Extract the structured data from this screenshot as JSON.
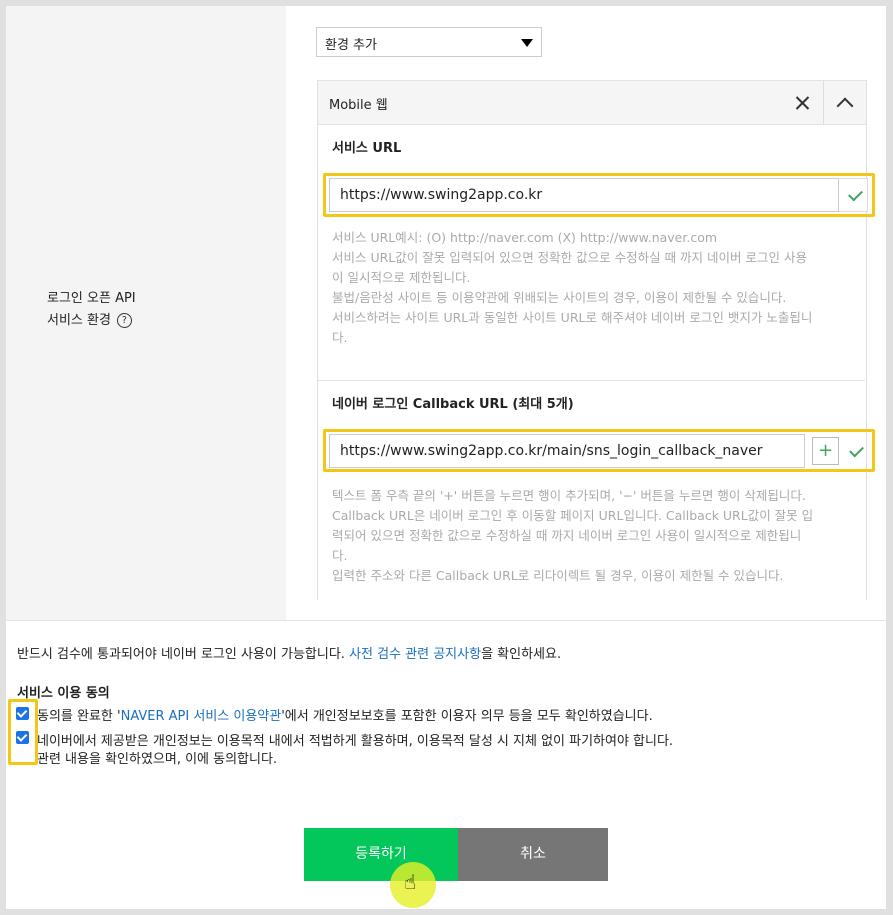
{
  "env_label": {
    "line1": "로그인 오픈 API",
    "line2": "서비스 환경",
    "help_glyph": "?"
  },
  "env_select": {
    "value": "환경 추가"
  },
  "env_panel": {
    "title": "Mobile 웹",
    "service_url": {
      "title": "서비스 URL",
      "value": "https://www.swing2app.co.kr",
      "help": [
        "서비스 URL예시: (O) http://naver.com (X) http://www.naver.com",
        "서비스 URL값이 잘못 입력되어 있으면 정확한 값으로 수정하실 때 까지 네이버 로그인 사용",
        "이 일시적으로 제한됩니다.",
        "불법/음란성 사이트 등 이용약관에 위배되는 사이트의 경우, 이용이 제한될 수 있습니다.",
        "서비스하려는 사이트 URL과 동일한 사이트 URL로 해주셔야 네이버 로그인 뱃지가 노출됩니",
        "다."
      ]
    },
    "callback_url": {
      "title": "네이버 로그인 Callback URL (최대 5개)",
      "value": "https://www.swing2app.co.kr/main/sns_login_callback_naver",
      "plus_label": "+",
      "help": [
        "텍스트 폼 우측 끝의 '+' 버튼을 누르면 행이 추가되며, '−' 버튼을 누르면 행이 삭제됩니다.",
        "Callback URL은 네이버 로그인 후 이동할 페이지 URL입니다. Callback URL값이 잘못 입",
        "력되어 있으면 정확한 값으로 수정하실 때 까지 네이버 로그인 사용이 일시적으로 제한됩니",
        "다.",
        "입력한 주소와 다른 Callback URL로 리다이렉트 될 경우, 이용이 제한될 수 있습니다."
      ]
    }
  },
  "notice": {
    "before": "반드시 검수에 통과되어야 네이버 로그인 사용이 가능합니다. ",
    "link": "사전 검수 관련 공지사항",
    "after": "을 확인하세요."
  },
  "agreement": {
    "title": "서비스 이용 동의",
    "item1": {
      "before": "동의를 완료한 '",
      "link": "NAVER API 서비스 이용약관",
      "after": "'에서 개인정보보호를 포함한 이용자 의무 등을 모두 확인하였습니다."
    },
    "item2_line1": "네이버에서 제공받은 개인정보는 이용목적 내에서 적법하게 활용하며, 이용목적 달성 시 지체 없이 파기하여야 합니다.",
    "item2_line2": "관련 내용을 확인하였으며, 이에 동의합니다."
  },
  "buttons": {
    "register": "등록하기",
    "cancel": "취소"
  },
  "cursor_glyph": "☝"
}
